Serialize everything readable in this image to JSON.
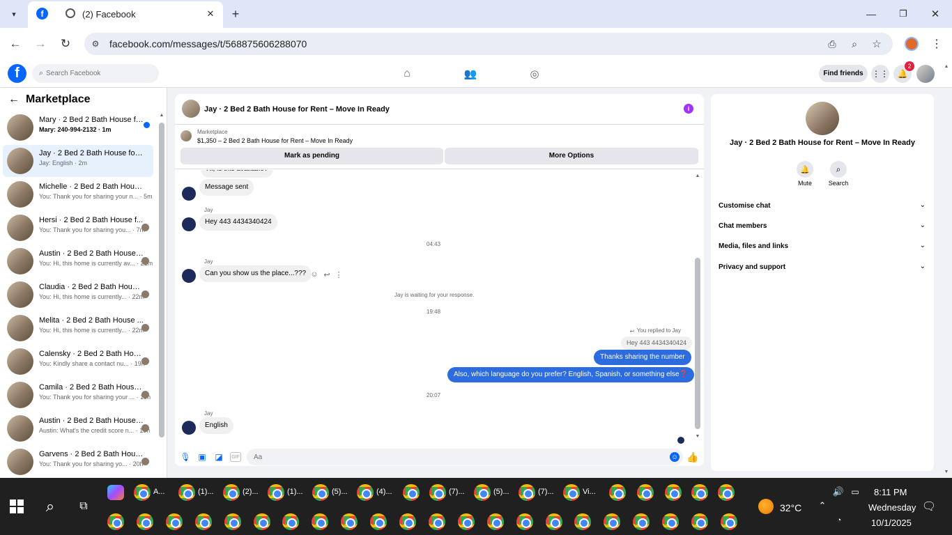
{
  "browser": {
    "tab_title": "(2) Facebook",
    "url": "facebook.com/messages/t/568875606288070"
  },
  "fb_header": {
    "search_placeholder": "Search Facebook",
    "find_friends": "Find friends",
    "notification_count": "2"
  },
  "sidebar": {
    "title": "Marketplace",
    "threads": [
      {
        "name": "Mary · 2 Bed 2 Bath House fo...",
        "preview": "Mary: 240-994-2132 · 1m",
        "unread": true
      },
      {
        "name": "Jay · 2 Bed 2 Bath House for Re...",
        "preview": "Jay: English · 2m",
        "selected": true
      },
      {
        "name": "Michelle · 2 Bed 2 Bath House f...",
        "preview": "You: Thank you for sharing your n... · 5m"
      },
      {
        "name": "Hersi · 2 Bed 2 Bath House f...",
        "preview": "You: Thank you for sharing you... · 7m"
      },
      {
        "name": "Austin · 2 Bed 2 Bath House for...",
        "preview": "You: Hi, this home is currently av... · 21m"
      },
      {
        "name": "Claudia · 2 Bed 2 Bath House...",
        "preview": "You: Hi, this home is currently... · 22m"
      },
      {
        "name": "Melita · 2 Bed 2 Bath House ...",
        "preview": "You: Hi, this home is currently... · 22m"
      },
      {
        "name": "Calensky · 2 Bed 2 Bath Hous...",
        "preview": "You: Kindly share a contact nu... · 19h"
      },
      {
        "name": "Camila · 2 Bed 2 Bath House fo...",
        "preview": "You: Thank you for sharing your ... · 19h"
      },
      {
        "name": "Austin · 2 Bed 2 Bath House for...",
        "preview": "Austin: What's the credit score n... · 19h"
      },
      {
        "name": "Garvens · 2 Bed 2 Bath Hous...",
        "preview": "You: Thank you for sharing yo... · 20h"
      }
    ]
  },
  "chat": {
    "title": "Jay · 2 Bed 2 Bath House for Rent – Move In Ready",
    "marketplace_label": "Marketplace",
    "listing": "$1,350 – 2 Bed 2 Bath House for Rent – Move In Ready",
    "mark_pending": "Mark as pending",
    "more_options": "More Options",
    "msg_partial": "Hi, is this available?",
    "msg_sent": "Message sent",
    "sender1": "Jay",
    "msg_hey": "Hey  443 4434340424",
    "time1": "04:43",
    "sender2": "Jay",
    "msg_show": "Can you show us the place...???",
    "waiting": "Jay is waiting for your response.",
    "time2": "19:48",
    "you_replied": "You replied to Jay",
    "quoted": "Hey  443 4434340424",
    "out1": "Thanks sharing the number",
    "out2": "Also, which language do you prefer? English, Spanish, or something else❓",
    "time3": "20:07",
    "sender3": "Jay",
    "msg_english": "English",
    "composer_placeholder": "Aa"
  },
  "info_panel": {
    "title": "Jay · 2 Bed 2 Bath House for Rent – Move In Ready",
    "mute": "Mute",
    "search": "Search",
    "sections": [
      "Customise chat",
      "Chat members",
      "Media, files and links",
      "Privacy and support"
    ]
  },
  "taskbar": {
    "top_row": [
      {
        "label": "A..."
      },
      {
        "label": "(1)..."
      },
      {
        "label": "(2)..."
      },
      {
        "label": "(1)..."
      },
      {
        "label": "(5)..."
      },
      {
        "label": "(4)..."
      },
      {
        "label": ""
      },
      {
        "label": "(7)..."
      },
      {
        "label": "(5)..."
      },
      {
        "label": "(7)..."
      },
      {
        "label": "Vi..."
      }
    ],
    "weather": "32°C",
    "time": "8:11 PM",
    "day": "Wednesday",
    "date": "10/1/2025"
  }
}
